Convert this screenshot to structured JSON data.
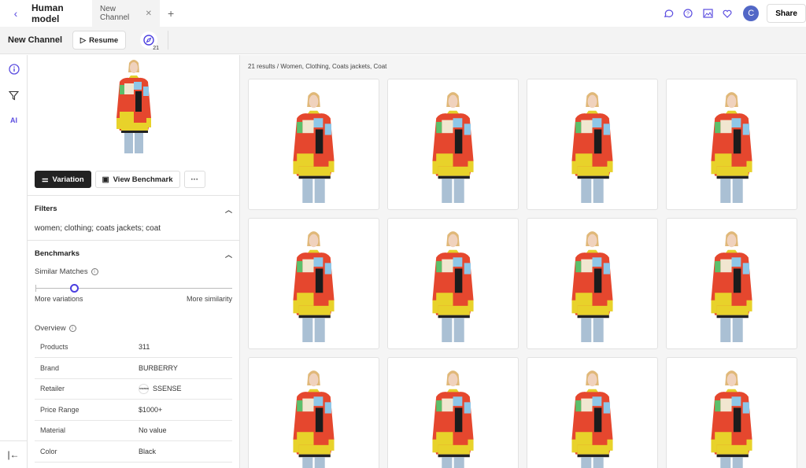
{
  "topbar": {
    "app_title": "Human model",
    "tab_label": "New Channel",
    "user_initial": "C",
    "share_label": "Share"
  },
  "subbar": {
    "channel_title": "New Channel",
    "resume_label": "Resume",
    "results_count": "21"
  },
  "rail": {
    "ai_label": "AI"
  },
  "panel": {
    "variation_label": "Variation",
    "benchmark_label": "View Benchmark",
    "filters_title": "Filters",
    "filters_text": "women; clothing; coats jackets; coat",
    "benchmarks_title": "Benchmarks",
    "similar_label": "Similar Matches",
    "slider_value": 0.2,
    "slider_min_label": "More variations",
    "slider_max_label": "More similarity",
    "overview_label": "Overview",
    "overview": [
      {
        "k": "Products",
        "v": "311"
      },
      {
        "k": "Brand",
        "v": "BURBERRY"
      },
      {
        "k": "Retailer",
        "v": "SSENSE"
      },
      {
        "k": "Price Range",
        "v": "$1000+"
      },
      {
        "k": "Material",
        "v": "No value"
      },
      {
        "k": "Color",
        "v": "Black"
      }
    ]
  },
  "main": {
    "breadcrumb": "21 results / Women, Clothing, Coats jackets, Coat",
    "product_count": 12
  },
  "colors": {
    "accent": "#5b4de0",
    "avatar": "#5267c6"
  }
}
